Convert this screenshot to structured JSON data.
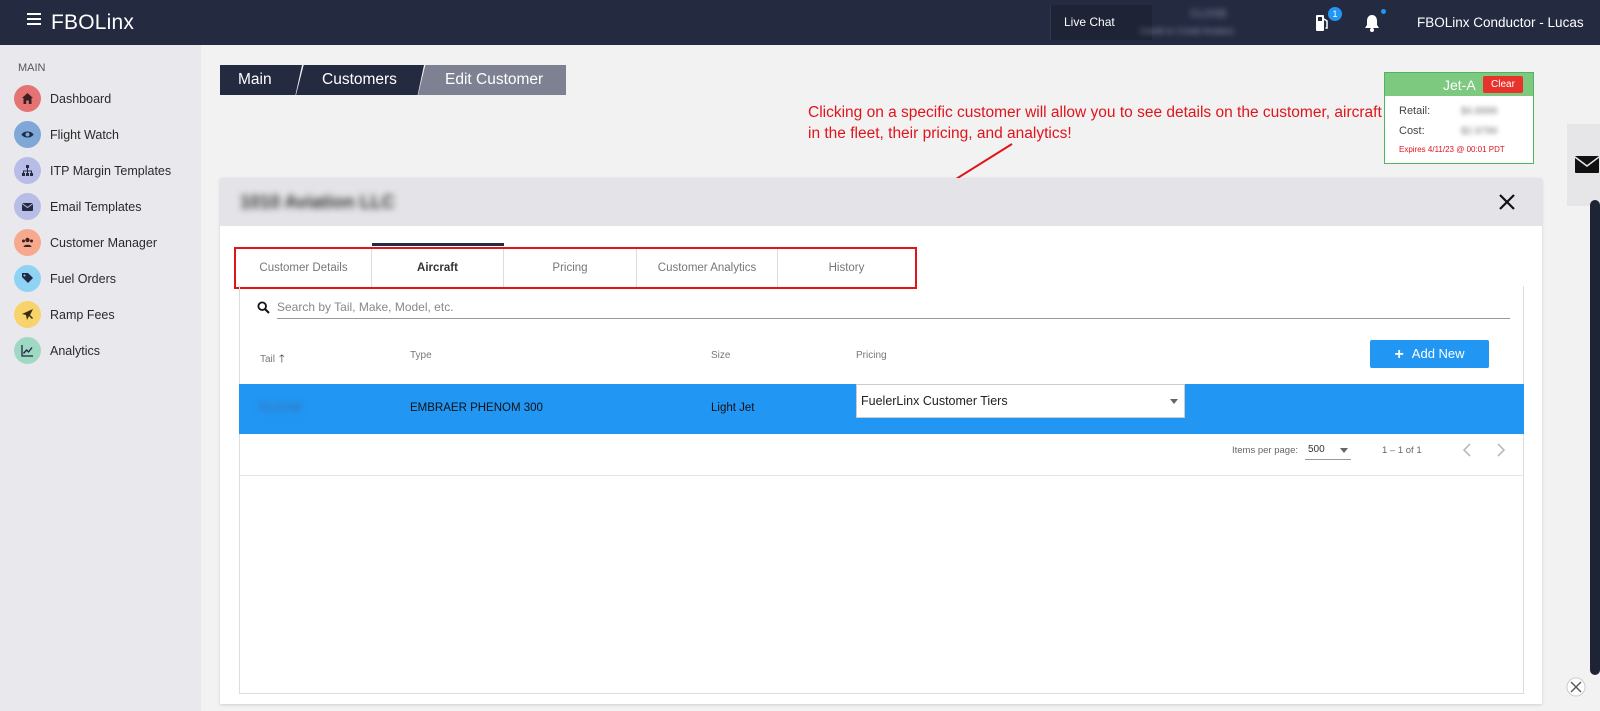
{
  "topbar": {
    "brand": "FBOLinx",
    "live_chat": "Live Chat",
    "blurred_line1": "CLOSE",
    "blurred_line2": "Credit to Credit Aviation",
    "fuel_badge": "1",
    "user": "FBOLinx Conductor - Lucas"
  },
  "sidebar": {
    "section": "MAIN",
    "items": [
      {
        "label": "Dashboard",
        "icon": "home-icon",
        "color": "#e57373"
      },
      {
        "label": "Flight Watch",
        "icon": "eye-icon",
        "color": "#7fa7d8"
      },
      {
        "label": "ITP Margin Templates",
        "icon": "sitemap-icon",
        "color": "#b7bde6"
      },
      {
        "label": "Email Templates",
        "icon": "envelope-icon",
        "color": "#b7bde6"
      },
      {
        "label": "Customer Manager",
        "icon": "users-icon",
        "color": "#f7a98e"
      },
      {
        "label": "Fuel Orders",
        "icon": "tags-icon",
        "color": "#8fd3f4"
      },
      {
        "label": "Ramp Fees",
        "icon": "plane-icon",
        "color": "#f7d36b"
      },
      {
        "label": "Analytics",
        "icon": "chart-line-icon",
        "color": "#9fd9c4"
      }
    ]
  },
  "breadcrumb": [
    "Main",
    "Customers",
    "Edit Customer"
  ],
  "annotation": "Clicking on a specific customer will allow you to see details on the customer, aircraft in the fleet, their pricing, and analytics!",
  "jet_card": {
    "title": "Jet-A",
    "clear": "Clear",
    "retail_label": "Retail:",
    "retail_value": "$4.8999",
    "cost_label": "Cost:",
    "cost_value": "$2.9799",
    "expires": "Expires 4/11/23 @ 00:01 PDT"
  },
  "panel": {
    "customer_name": "1010 Aviation LLC",
    "tabs": [
      "Customer Details",
      "Aircraft",
      "Pricing",
      "Customer Analytics",
      "History"
    ],
    "active_tab": "Aircraft",
    "search_placeholder": "Search by Tail, Make, Model, etc.",
    "columns": [
      "Tail",
      "Type",
      "Size",
      "Pricing"
    ],
    "add_new": "Add New",
    "rows": [
      {
        "tail": "N123AB",
        "type": "EMBRAER PHENOM 300",
        "size": "Light Jet",
        "pricing": "FuelerLinx Customer Tiers"
      }
    ],
    "pager": {
      "items_per_page_label": "Items per page:",
      "items_per_page": "500",
      "range": "1 – 1 of 1"
    }
  },
  "colors": {
    "topbar": "#242a40",
    "accent_blue": "#2196f3",
    "annotation_red": "#e0141b",
    "jet_green": "#7dc97f"
  }
}
